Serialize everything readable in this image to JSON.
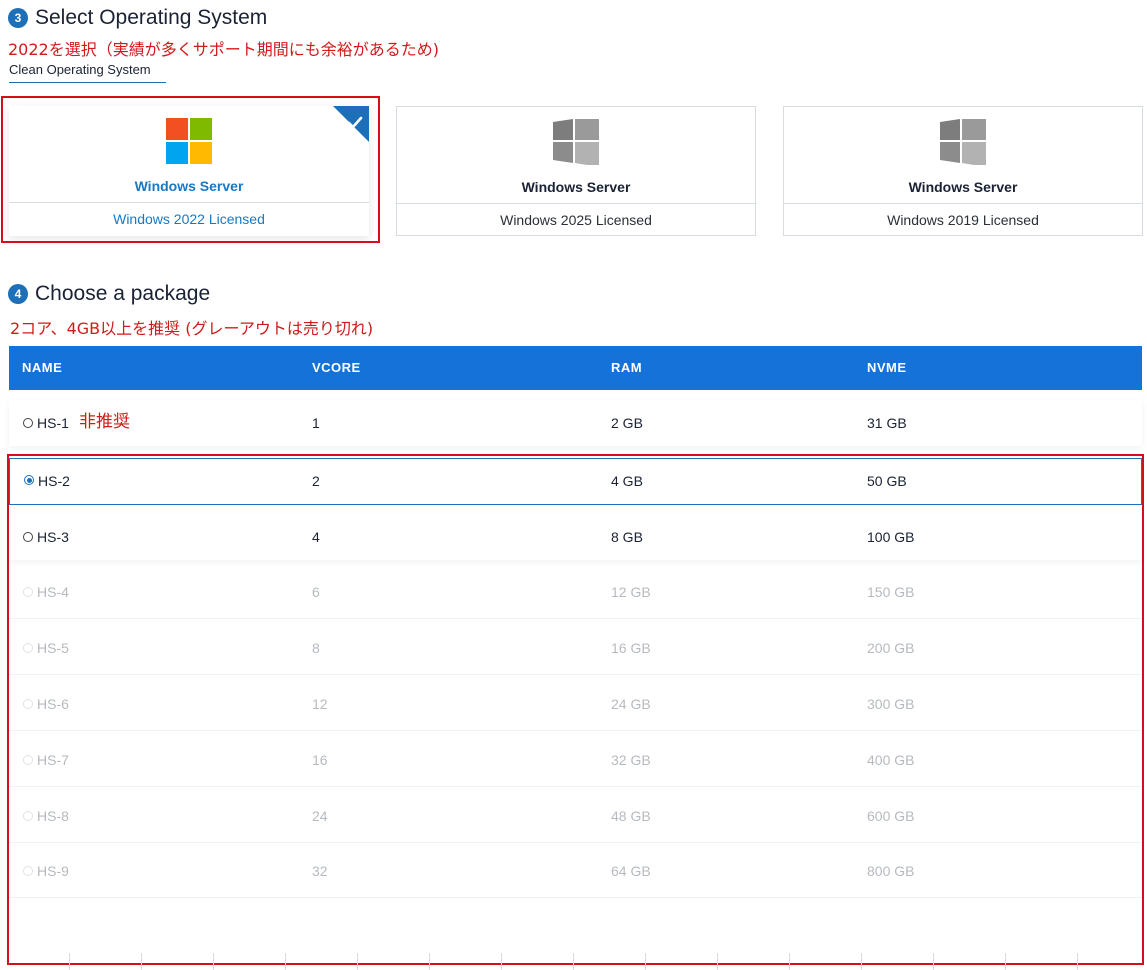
{
  "section3": {
    "number": "3",
    "title": "Select Operating System",
    "note": "2022を選択（実績が多くサポート期間にも余裕があるため)"
  },
  "os_tab": {
    "label": "Clean Operating System"
  },
  "os_options": [
    {
      "name": "Windows Server",
      "version": "Windows 2022 Licensed",
      "selected": true
    },
    {
      "name": "Windows Server",
      "version": "Windows 2025 Licensed",
      "selected": false
    },
    {
      "name": "Windows Server",
      "version": "Windows 2019 Licensed",
      "selected": false
    }
  ],
  "section4": {
    "number": "4",
    "title": "Choose a package",
    "note": "2コア、4GB以上を推奨 (グレーアウトは売り切れ)"
  },
  "table": {
    "headers": {
      "name": "NAME",
      "vcore": "VCORE",
      "ram": "RAM",
      "nvme": "NVME"
    },
    "rows": [
      {
        "name": "HS-1",
        "vcore": "1",
        "ram": "2 GB",
        "nvme": "31 GB",
        "tag": "非推奨"
      },
      {
        "name": "HS-2",
        "vcore": "2",
        "ram": "4 GB",
        "nvme": "50 GB"
      },
      {
        "name": "HS-3",
        "vcore": "4",
        "ram": "8 GB",
        "nvme": "100 GB"
      },
      {
        "name": "HS-4",
        "vcore": "6",
        "ram": "12 GB",
        "nvme": "150 GB"
      },
      {
        "name": "HS-5",
        "vcore": "8",
        "ram": "16 GB",
        "nvme": "200 GB"
      },
      {
        "name": "HS-6",
        "vcore": "12",
        "ram": "24 GB",
        "nvme": "300 GB"
      },
      {
        "name": "HS-7",
        "vcore": "16",
        "ram": "32 GB",
        "nvme": "400 GB"
      },
      {
        "name": "HS-8",
        "vcore": "24",
        "ram": "48 GB",
        "nvme": "600 GB"
      },
      {
        "name": "HS-9",
        "vcore": "32",
        "ram": "64 GB",
        "nvme": "800 GB"
      }
    ]
  },
  "colors": {
    "accent": "#1572d8",
    "annotation": "#d40f1a",
    "disabled_text": "#b6bac0"
  },
  "icons": {
    "os_logo": "windows-logo-icon",
    "selected_mark": "checkmark-icon"
  }
}
